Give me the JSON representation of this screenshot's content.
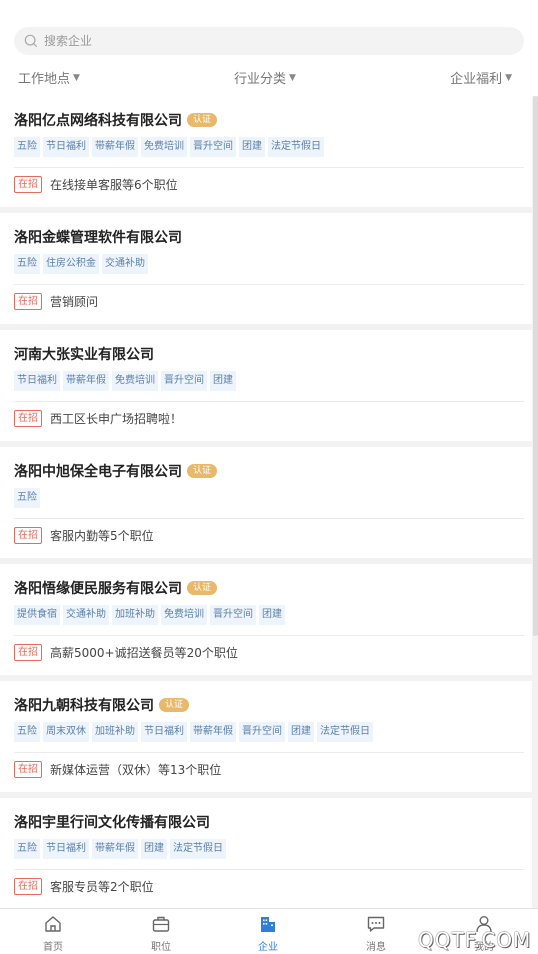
{
  "search": {
    "placeholder": "搜索企业"
  },
  "filters": [
    {
      "label": "工作地点"
    },
    {
      "label": "行业分类"
    },
    {
      "label": "企业福利"
    }
  ],
  "companies": [
    {
      "name": "洛阳亿点网络科技有限公司",
      "certified": true,
      "badge": "认证",
      "tags": [
        "五险",
        "节日福利",
        "带薪年假",
        "免费培训",
        "晋升空间",
        "团建",
        "法定节假日"
      ],
      "hiring": "在招",
      "jobs": "在线接单客服等6个职位"
    },
    {
      "name": "洛阳金蝶管理软件有限公司",
      "certified": false,
      "badge": "",
      "tags": [
        "五险",
        "住房公积金",
        "交通补助"
      ],
      "hiring": "在招",
      "jobs": "营销顾问"
    },
    {
      "name": "河南大张实业有限公司",
      "certified": false,
      "badge": "",
      "tags": [
        "节日福利",
        "带薪年假",
        "免费培训",
        "晋升空间",
        "团建"
      ],
      "hiring": "在招",
      "jobs": "西工区长申广场招聘啦！"
    },
    {
      "name": "洛阳中旭保全电子有限公司",
      "certified": true,
      "badge": "认证",
      "tags": [
        "五险"
      ],
      "hiring": "在招",
      "jobs": "客服内勤等5个职位"
    },
    {
      "name": "洛阳悟缘便民服务有限公司",
      "certified": true,
      "badge": "认证",
      "tags": [
        "提供食宿",
        "交通补助",
        "加班补助",
        "免费培训",
        "晋升空间",
        "团建"
      ],
      "hiring": "在招",
      "jobs": "高薪5000+诚招送餐员等20个职位"
    },
    {
      "name": "洛阳九朝科技有限公司",
      "certified": true,
      "badge": "认证",
      "tags": [
        "五险",
        "周末双休",
        "加班补助",
        "节日福利",
        "带薪年假",
        "晋升空间",
        "团建",
        "法定节假日"
      ],
      "hiring": "在招",
      "jobs": "新媒体运营（双休）等13个职位"
    },
    {
      "name": "洛阳宇里行间文化传播有限公司",
      "certified": false,
      "badge": "",
      "tags": [
        "五险",
        "节日福利",
        "带薪年假",
        "团建",
        "法定节假日"
      ],
      "hiring": "在招",
      "jobs": "客服专员等2个职位"
    }
  ],
  "tabs": [
    {
      "label": "首页",
      "icon": "home-icon"
    },
    {
      "label": "职位",
      "icon": "briefcase-icon"
    },
    {
      "label": "企业",
      "icon": "building-icon"
    },
    {
      "label": "消息",
      "icon": "message-icon"
    },
    {
      "label": "我的",
      "icon": "user-icon"
    }
  ],
  "active_tab": "企业",
  "watermark": "QQTF.COM",
  "colors": {
    "accent": "#2f7fd8",
    "badge": "#e8b96a",
    "hiring": "#e76b5a",
    "tag_bg": "#eef4fc",
    "tag_text": "#5a7fa9"
  }
}
